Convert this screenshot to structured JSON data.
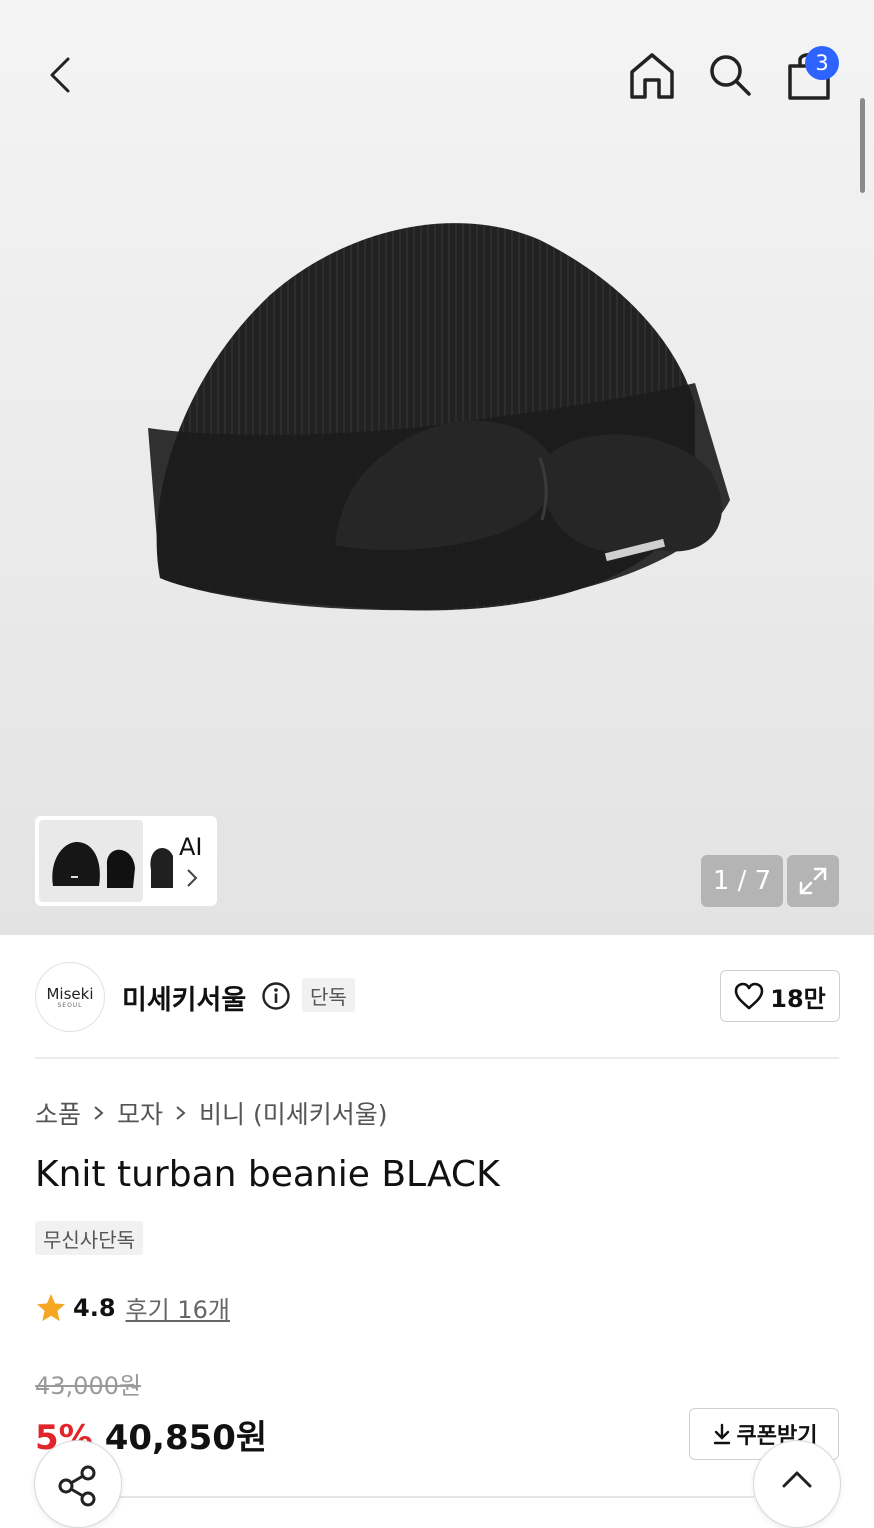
{
  "header": {
    "cart_count": "3"
  },
  "gallery": {
    "ai_label": "AI",
    "counter": "1 / 7"
  },
  "brand": {
    "logo_text": "Miseki",
    "logo_subtext": "SEOUL",
    "name": "미세키서울",
    "exclusive_tag": "단독",
    "likes": "18만"
  },
  "breadcrumb": [
    "소품",
    "모자",
    "비니 (미세키서울)"
  ],
  "product": {
    "title": "Knit turban beanie BLACK",
    "tag": "무신사단독",
    "rating": "4.8",
    "reviews": "후기 16개",
    "original_price": "43,000원",
    "discount": "5%",
    "price": "40,850원",
    "coupon_label": "쿠폰받기"
  },
  "colors": {
    "badge": "#2e63ff",
    "discount": "#e2252a",
    "star": "#f5a623"
  }
}
